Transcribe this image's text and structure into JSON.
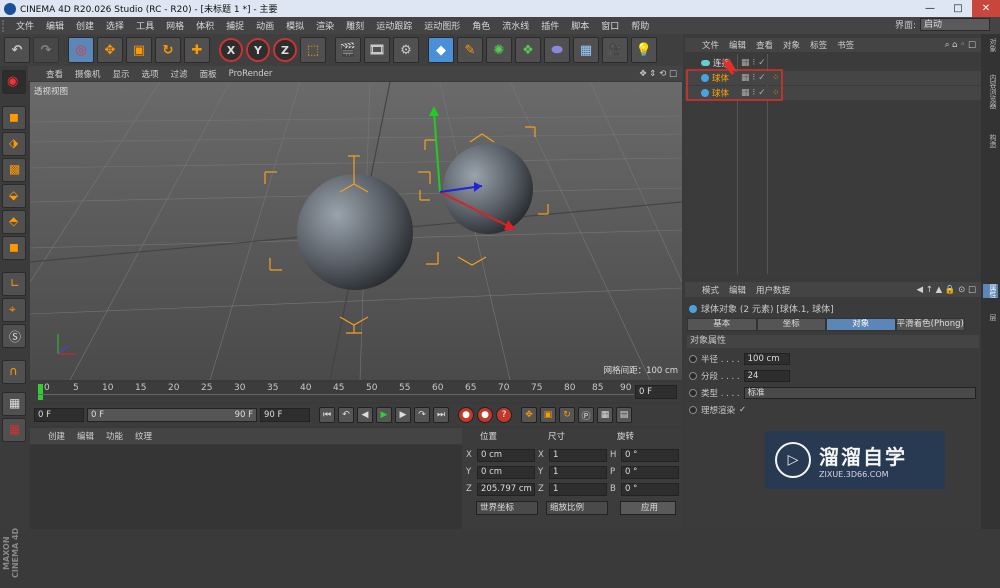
{
  "window": {
    "title": "CINEMA 4D R20.026 Studio (RC - R20) - [未标题 1 *] - 主要",
    "min": "—",
    "max": "□",
    "close": "✕"
  },
  "menu": [
    "文件",
    "编辑",
    "创建",
    "选择",
    "工具",
    "网格",
    "体积",
    "捕捉",
    "动画",
    "模拟",
    "渲染",
    "雕刻",
    "运动跟踪",
    "运动图形",
    "角色",
    "流水线",
    "插件",
    "脚本",
    "窗口",
    "帮助"
  ],
  "layout": {
    "label": "界面:",
    "value": "启动"
  },
  "toolbar": {
    "undo_icon": "↶",
    "axis_x": "X",
    "axis_y": "Y",
    "axis_z": "Z"
  },
  "viewport": {
    "menu": [
      "查看",
      "摄像机",
      "显示",
      "选项",
      "过滤",
      "面板",
      "ProRender"
    ],
    "label": "透视视图",
    "grid_spacing": "网格间距：100 cm"
  },
  "timeline": {
    "ticks": [
      "0",
      "5",
      "10",
      "15",
      "20",
      "25",
      "30",
      "35",
      "40",
      "45",
      "50",
      "55",
      "60",
      "65",
      "70",
      "75",
      "80",
      "85",
      "90"
    ],
    "end_frame": "0 F"
  },
  "transport": {
    "start": "0 F",
    "range_start": "0 F",
    "range_end": "90 F",
    "end": "90 F"
  },
  "material": {
    "menu": [
      "创建",
      "编辑",
      "功能",
      "纹理"
    ]
  },
  "coords": {
    "headers": [
      "位置",
      "尺寸",
      "旋转"
    ],
    "rows": [
      {
        "a": "X",
        "pos": "0 cm",
        "b": "X",
        "size": "1",
        "c": "H",
        "rot": "0 °"
      },
      {
        "a": "Y",
        "pos": "0 cm",
        "b": "Y",
        "size": "1",
        "c": "P",
        "rot": "0 °"
      },
      {
        "a": "Z",
        "pos": "205.797 cm",
        "b": "Z",
        "size": "1",
        "c": "B",
        "rot": "0 °"
      }
    ],
    "world": "世界坐标",
    "scale": "缩放比例",
    "apply": "应用"
  },
  "objects": {
    "menu": [
      "文件",
      "编辑",
      "查看",
      "对象",
      "标签",
      "书签"
    ],
    "items": [
      {
        "name": "连接",
        "kind": "connect"
      },
      {
        "name": "球体",
        "kind": "sphere"
      },
      {
        "name": "球体",
        "kind": "sphere"
      }
    ]
  },
  "attributes": {
    "menu": [
      "模式",
      "编辑",
      "用户数据"
    ],
    "title": "球体对象 (2 元素) [球体.1, 球体]",
    "tabs": [
      "基本",
      "坐标",
      "对象",
      "平滑着色(Phong)"
    ],
    "section": "对象属性",
    "props": [
      {
        "label": "半径 . . . .",
        "value": "100 cm"
      },
      {
        "label": "分段 . . . .",
        "value": "24"
      },
      {
        "label": "类型 . . . .",
        "value": "标准"
      },
      {
        "label": "理想渲染",
        "value": "✓"
      }
    ]
  },
  "rightstrip": [
    "对象",
    "内容浏览器",
    "构造",
    "属性",
    "层"
  ],
  "watermark": {
    "brand": "溜溜自学",
    "url": "ZIXUE.3D66.COM"
  },
  "maxon": "MAXON CINEMA 4D",
  "colors": {
    "accent": "#5b86b8",
    "highlight_red": "#e0302b",
    "object_orange": "#ffa500"
  }
}
